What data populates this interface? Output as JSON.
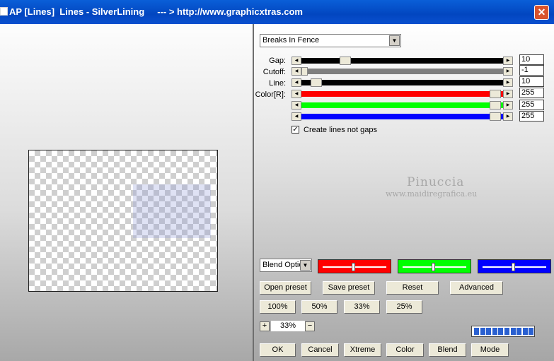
{
  "window": {
    "title": "AP [Lines]  Lines - SilverLining     --- > http://www.graphicxtras.com",
    "close_glyph": "✕"
  },
  "preset_dropdown": {
    "value": "Breaks In Fence"
  },
  "params": {
    "gap": {
      "label": "Gap:",
      "value": "10",
      "level": 0.22
    },
    "cutoff": {
      "label": "Cutoff:",
      "value": "-1",
      "level": 0.0
    },
    "line": {
      "label": "Line:",
      "value": "10",
      "level": 0.03
    },
    "color_label": "Color[R]:",
    "red": {
      "value": "255",
      "level": 1.0,
      "color": "#ff0000"
    },
    "green": {
      "value": "255",
      "level": 1.0,
      "color": "#00ff00"
    },
    "blue": {
      "value": "255",
      "level": 1.0,
      "color": "#0000ff"
    }
  },
  "checkbox": {
    "label": "Create lines not gaps",
    "checked": true,
    "mark": "✓"
  },
  "watermark": {
    "line1": "Pinuccia",
    "line2": "www.maidiregrafica.eu"
  },
  "blend_dropdown": {
    "value": "Blend Optio"
  },
  "color_sliders": [
    {
      "color": "#ff0000",
      "level": 0.5
    },
    {
      "color": "#00ff00",
      "level": 0.5
    },
    {
      "color": "#0000ff",
      "level": 0.5
    }
  ],
  "preset_buttons": {
    "open": "Open preset",
    "save": "Save preset",
    "reset": "Reset",
    "advanced": "Advanced"
  },
  "zoom_buttons": {
    "z100": "100%",
    "z50": "50%",
    "z33": "33%",
    "z25": "25%"
  },
  "zoom": {
    "plus": "+",
    "minus": "−",
    "value": "33%"
  },
  "progress": {
    "level": 1.0,
    "segments": 10
  },
  "bottom_buttons": {
    "ok": "OK",
    "cancel": "Cancel",
    "xtreme": "Xtreme",
    "color": "Color",
    "blend": "Blend",
    "mode": "Mode"
  },
  "colors": {
    "titlebar": "#0246c0",
    "accent_blue": "#2a60d0"
  }
}
